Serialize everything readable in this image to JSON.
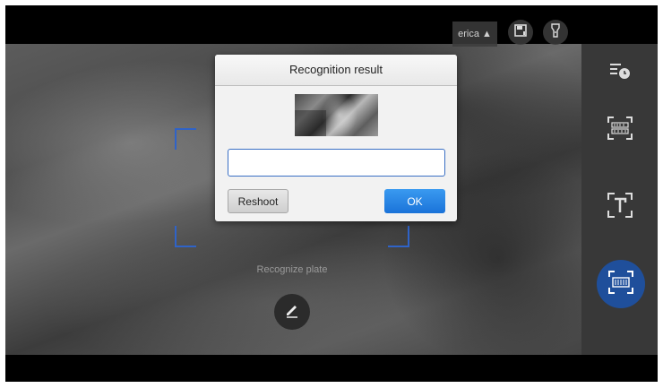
{
  "dialog": {
    "title": "Recognition result",
    "input_value": "",
    "reshoot_label": "Reshoot",
    "ok_label": "OK"
  },
  "camera": {
    "region_label": "erica ▲",
    "hint_text": "Recognize plate"
  },
  "side_panel": {
    "items": [
      {
        "icon": "history-icon"
      },
      {
        "icon": "barcode-scan-icon"
      },
      {
        "icon": "text-recognition-icon"
      },
      {
        "icon": "plate-scan-icon",
        "active": true
      }
    ]
  },
  "colors": {
    "accent": "#2f63c8",
    "ok_button": "#1a73d9",
    "active_mode": "#1f4f9b"
  }
}
